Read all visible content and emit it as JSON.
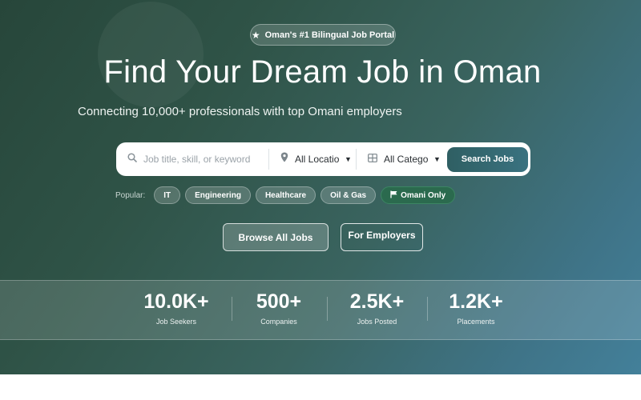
{
  "hero": {
    "badge": "Oman's #1 Bilingual Job Portal",
    "title": "Find Your Dream Job in Oman",
    "subtitle": "Connecting 10,000+ professionals with top Omani employers"
  },
  "search": {
    "keyword_placeholder": "Job title, skill, or keyword",
    "location_value": "All Locations",
    "category_value": "All Categories",
    "button_label": "Search Jobs"
  },
  "popular": {
    "label": "Popular:",
    "chips": [
      "IT",
      "Engineering",
      "Healthcare",
      "Oil & Gas",
      "Omani Only"
    ]
  },
  "actions": {
    "browse_label": "Browse All Jobs",
    "employers_label": "For Employers"
  },
  "stats": [
    {
      "value": "10.0K+",
      "label": "Job Seekers"
    },
    {
      "value": "500+",
      "label": "Companies"
    },
    {
      "value": "2.5K+",
      "label": "Jobs Posted"
    },
    {
      "value": "1.2K+",
      "label": "Placements"
    }
  ],
  "icons": {
    "badge": "star-icon",
    "keyword": "search-icon",
    "location": "map-pin-icon",
    "category": "grid-icon",
    "omani_chip": "flag-icon",
    "dropdown": "chevron-down-icon"
  },
  "colors": {
    "hero_start": "#27463a",
    "hero_end": "#43809a",
    "search_button": "#2f5f63",
    "active_chip": "#2b6a4e"
  }
}
